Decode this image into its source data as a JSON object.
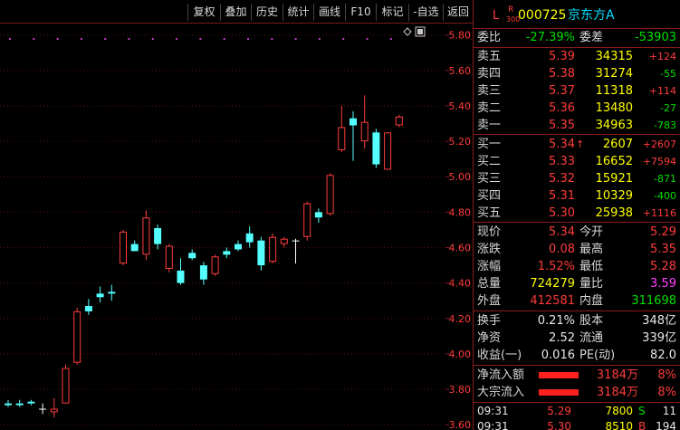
{
  "toolbar": {
    "buttons": [
      "复权",
      "叠加",
      "历史",
      "统计",
      "画线",
      "F10",
      "标记",
      "-自选",
      "返回"
    ]
  },
  "price_axis": {
    "ticks": [
      "5.80",
      "5.60",
      "5.40",
      "5.20",
      "5.00",
      "4.80",
      "4.60",
      "4.40",
      "4.20",
      "4.00",
      "3.80",
      "3.60"
    ]
  },
  "stock": {
    "marker_L": "L",
    "marker_R": "R",
    "marker_300": "300",
    "code": "000725",
    "name": "京东方A"
  },
  "weibi": {
    "label": "委比",
    "value": "-27.39%",
    "diff_label": "委差",
    "diff_value": "-53903"
  },
  "asks": [
    {
      "label": "卖五",
      "price": "5.39",
      "volume": "34315",
      "change": "+124"
    },
    {
      "label": "卖四",
      "price": "5.38",
      "volume": "31274",
      "change": "-55"
    },
    {
      "label": "卖三",
      "price": "5.37",
      "volume": "11318",
      "change": "+114"
    },
    {
      "label": "卖二",
      "price": "5.36",
      "volume": "13480",
      "change": "-27"
    },
    {
      "label": "卖一",
      "price": "5.35",
      "volume": "34963",
      "change": "-783"
    }
  ],
  "bids": [
    {
      "label": "买一",
      "price": "5.34",
      "arrow": "↑",
      "volume": "2607",
      "change": "+2607"
    },
    {
      "label": "买二",
      "price": "5.33",
      "volume": "16652",
      "change": "+7594"
    },
    {
      "label": "买三",
      "price": "5.32",
      "volume": "15921",
      "change": "-871"
    },
    {
      "label": "买四",
      "price": "5.31",
      "volume": "10329",
      "change": "-400"
    },
    {
      "label": "买五",
      "price": "5.30",
      "volume": "25938",
      "change": "+1116"
    }
  ],
  "quote": {
    "xianjia_label": "现价",
    "xianjia": "5.34",
    "jinkai_label": "今开",
    "jinkai": "5.29",
    "zhangdie_label": "涨跌",
    "zhangdie": "0.08",
    "zuigao_label": "最高",
    "zuigao": "5.35",
    "zhangfu_label": "涨幅",
    "zhangfu": "1.52%",
    "zuidi_label": "最低",
    "zuidi": "5.28",
    "zongliang_label": "总量",
    "zongliang": "724279",
    "liangbi_label": "量比",
    "liangbi": "3.59",
    "waipan_label": "外盘",
    "waipan": "412581",
    "neipan_label": "内盘",
    "neipan": "311698"
  },
  "fundamentals": {
    "huanshou_label": "换手",
    "huanshou": "0.21%",
    "guben_label": "股本",
    "guben": "348亿",
    "jingzi_label": "净资",
    "jingzi": "2.52",
    "liutong_label": "流通",
    "liutong": "339亿",
    "shouyi_label": "收益(一)",
    "shouyi": "0.016",
    "pe_label": "PE(动)",
    "pe": "82.0"
  },
  "flows": [
    {
      "label": "净流入额",
      "amount": "3184万",
      "pct": "8%"
    },
    {
      "label": "大宗流入",
      "amount": "3184万",
      "pct": "8%"
    }
  ],
  "ticks": [
    {
      "time": "09:31",
      "price": "5.29",
      "volume": "7800",
      "side": "S"
    },
    {
      "time": "09:31",
      "price": "5.30",
      "volume": "8510",
      "side": "B"
    }
  ],
  "ticks_extra": [
    "11",
    "194"
  ],
  "colors": {
    "up": "#ff3c3c",
    "down": "#54ffff",
    "flat": "#ffffff",
    "separator": "#8b1a1a"
  },
  "chart_data": {
    "type": "candlestick",
    "ylim": [
      3.57,
      5.86
    ],
    "y_ticks": [
      3.6,
      3.8,
      4.0,
      4.2,
      4.4,
      4.6,
      4.8,
      5.0,
      5.2,
      5.4,
      5.6,
      5.8
    ],
    "candles": [
      {
        "o": 3.72,
        "h": 3.74,
        "l": 3.7,
        "c": 3.71,
        "kind": "down"
      },
      {
        "o": 3.72,
        "h": 3.74,
        "l": 3.7,
        "c": 3.71,
        "kind": "down"
      },
      {
        "o": 3.73,
        "h": 3.74,
        "l": 3.71,
        "c": 3.72,
        "kind": "down"
      },
      {
        "o": 3.69,
        "h": 3.72,
        "l": 3.66,
        "c": 3.69,
        "kind": "flat"
      },
      {
        "o": 3.67,
        "h": 3.75,
        "l": 3.64,
        "c": 3.69,
        "kind": "up"
      },
      {
        "o": 3.72,
        "h": 3.94,
        "l": 3.72,
        "c": 3.92,
        "kind": "up"
      },
      {
        "o": 3.95,
        "h": 4.26,
        "l": 3.94,
        "c": 4.24,
        "kind": "up"
      },
      {
        "o": 4.27,
        "h": 4.31,
        "l": 4.22,
        "c": 4.24,
        "kind": "down"
      },
      {
        "o": 4.34,
        "h": 4.38,
        "l": 4.29,
        "c": 4.32,
        "kind": "down"
      },
      {
        "o": 4.35,
        "h": 4.39,
        "l": 4.3,
        "c": 4.34,
        "kind": "down"
      },
      {
        "o": 4.51,
        "h": 4.7,
        "l": 4.5,
        "c": 4.69,
        "kind": "up"
      },
      {
        "o": 4.62,
        "h": 4.64,
        "l": 4.58,
        "c": 4.58,
        "kind": "down"
      },
      {
        "o": 4.56,
        "h": 4.81,
        "l": 4.53,
        "c": 4.77,
        "kind": "up"
      },
      {
        "o": 4.71,
        "h": 4.73,
        "l": 4.59,
        "c": 4.62,
        "kind": "down"
      },
      {
        "o": 4.48,
        "h": 4.62,
        "l": 4.46,
        "c": 4.61,
        "kind": "up"
      },
      {
        "o": 4.47,
        "h": 4.54,
        "l": 4.39,
        "c": 4.4,
        "kind": "down"
      },
      {
        "o": 4.57,
        "h": 4.59,
        "l": 4.53,
        "c": 4.54,
        "kind": "down"
      },
      {
        "o": 4.5,
        "h": 4.52,
        "l": 4.39,
        "c": 4.42,
        "kind": "down"
      },
      {
        "o": 4.45,
        "h": 4.56,
        "l": 4.44,
        "c": 4.55,
        "kind": "up"
      },
      {
        "o": 4.58,
        "h": 4.6,
        "l": 4.54,
        "c": 4.56,
        "kind": "down"
      },
      {
        "o": 4.62,
        "h": 4.64,
        "l": 4.58,
        "c": 4.59,
        "kind": "down"
      },
      {
        "o": 4.68,
        "h": 4.72,
        "l": 4.6,
        "c": 4.63,
        "kind": "down"
      },
      {
        "o": 4.64,
        "h": 4.66,
        "l": 4.47,
        "c": 4.5,
        "kind": "down"
      },
      {
        "o": 4.52,
        "h": 4.68,
        "l": 4.51,
        "c": 4.66,
        "kind": "up"
      },
      {
        "o": 4.62,
        "h": 4.66,
        "l": 4.6,
        "c": 4.65,
        "kind": "up"
      },
      {
        "o": 4.64,
        "h": 4.65,
        "l": 4.51,
        "c": 4.64,
        "kind": "flat"
      },
      {
        "o": 4.66,
        "h": 4.86,
        "l": 4.64,
        "c": 4.85,
        "kind": "up"
      },
      {
        "o": 4.8,
        "h": 4.82,
        "l": 4.74,
        "c": 4.77,
        "kind": "down"
      },
      {
        "o": 4.79,
        "h": 5.02,
        "l": 4.78,
        "c": 5.01,
        "kind": "up"
      },
      {
        "o": 5.15,
        "h": 5.4,
        "l": 5.14,
        "c": 5.28,
        "kind": "up"
      },
      {
        "o": 5.33,
        "h": 5.37,
        "l": 5.09,
        "c": 5.29,
        "kind": "down"
      },
      {
        "o": 5.31,
        "h": 5.46,
        "l": 5.16,
        "c": 5.2,
        "kind": "up"
      },
      {
        "o": 5.25,
        "h": 5.27,
        "l": 5.05,
        "c": 5.07,
        "kind": "down"
      },
      {
        "o": 5.04,
        "h": 5.25,
        "l": 5.04,
        "c": 5.25,
        "kind": "up"
      },
      {
        "o": 5.29,
        "h": 5.35,
        "l": 5.28,
        "c": 5.34,
        "kind": "up"
      }
    ]
  }
}
